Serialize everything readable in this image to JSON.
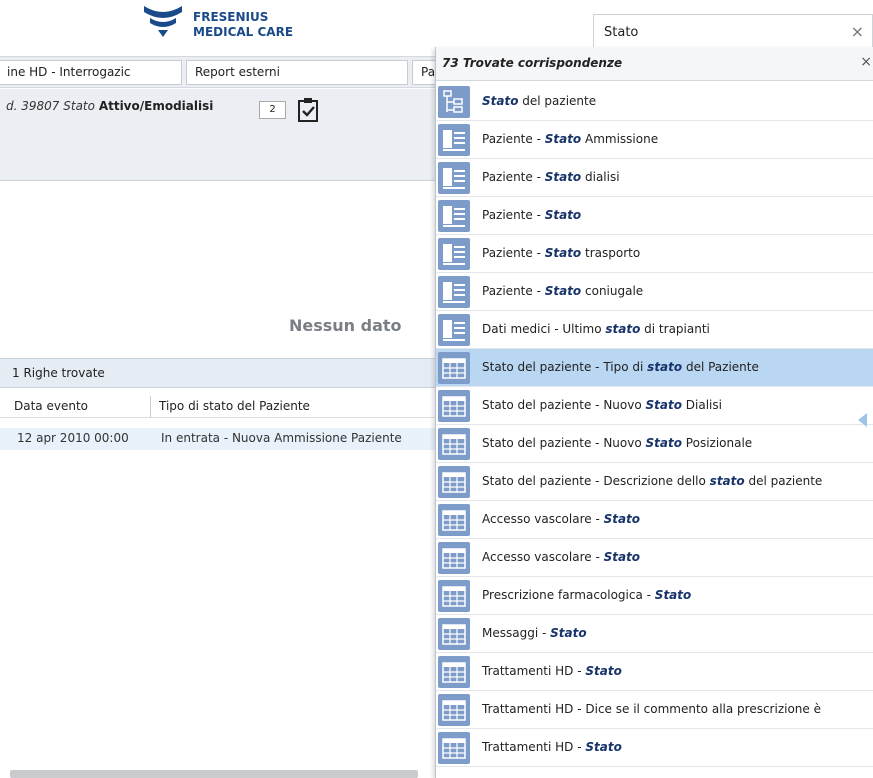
{
  "header": {
    "brand_line1": "FRESENIUS",
    "brand_line2": "MEDICAL CARE",
    "search_value": "Stato",
    "search_clear_label": "×"
  },
  "tabs": [
    {
      "label": "ine HD - Interrogazic"
    },
    {
      "label": "Report esterni"
    },
    {
      "label": "Pa"
    }
  ],
  "patient_info": {
    "id_label": "d. 39807",
    "status_label": "Stato",
    "status_value": "Attivo/Emodialisi",
    "badge": "2"
  },
  "main": {
    "empty_message": "Nessun dato",
    "rows_found": "1 Righe trovate",
    "columns": [
      "Data evento",
      "Tipo di stato del Paziente"
    ],
    "rows": [
      {
        "date": "12 apr 2010 00:00",
        "type": "In entrata - Nuova Ammissione Paziente"
      }
    ]
  },
  "dropdown": {
    "count_label": "73 Trovate corrispondenze",
    "close_label": "×",
    "items": [
      {
        "icon": "tree-icon",
        "pre": "",
        "match": "Stato",
        "post": " del paziente"
      },
      {
        "icon": "form-icon",
        "pre": "Paziente - ",
        "match": "Stato",
        "post": " Ammissione"
      },
      {
        "icon": "form-icon",
        "pre": "Paziente - ",
        "match": "Stato",
        "post": " dialisi"
      },
      {
        "icon": "form-icon",
        "pre": "Paziente - ",
        "match": "Stato",
        "post": ""
      },
      {
        "icon": "form-icon",
        "pre": "Paziente - ",
        "match": "Stato",
        "post": " trasporto"
      },
      {
        "icon": "form-icon",
        "pre": "Paziente - ",
        "match": "Stato",
        "post": " coniugale"
      },
      {
        "icon": "form-icon",
        "pre": "Dati medici - Ultimo ",
        "match": "stato",
        "post": " di trapianti"
      },
      {
        "icon": "table-icon",
        "pre": "Stato del paziente - Tipo di ",
        "match": "stato",
        "post": " del Paziente",
        "selected": true
      },
      {
        "icon": "table-icon",
        "pre": "Stato del paziente - Nuovo ",
        "match": "Stato",
        "post": " Dialisi"
      },
      {
        "icon": "table-icon",
        "pre": "Stato del paziente - Nuovo ",
        "match": "Stato",
        "post": " Posizionale"
      },
      {
        "icon": "table-icon",
        "pre": "Stato del paziente - Descrizione dello ",
        "match": "stato",
        "post": " del paziente"
      },
      {
        "icon": "table-icon",
        "pre": "Accesso vascolare - ",
        "match": "Stato",
        "post": ""
      },
      {
        "icon": "table-icon",
        "pre": "Accesso vascolare - ",
        "match": "Stato",
        "post": ""
      },
      {
        "icon": "table-icon",
        "pre": "Prescrizione farmacologica - ",
        "match": "Stato",
        "post": ""
      },
      {
        "icon": "table-icon",
        "pre": "Messaggi - ",
        "match": "Stato",
        "post": ""
      },
      {
        "icon": "table-icon",
        "pre": "Trattamenti HD - ",
        "match": "Stato",
        "post": ""
      },
      {
        "icon": "table-icon",
        "pre": "Trattamenti HD - Dice se il commento alla prescrizione è",
        "match": "",
        "post": ""
      },
      {
        "icon": "table-icon",
        "pre": "Trattamenti HD - ",
        "match": "Stato",
        "post": ""
      }
    ]
  }
}
